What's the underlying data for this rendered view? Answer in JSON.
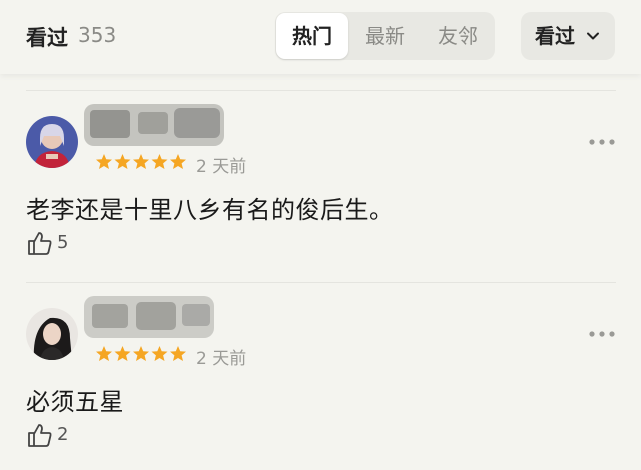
{
  "header": {
    "title": "看过",
    "count": "353",
    "tabs": [
      {
        "label": "热门",
        "active": true
      },
      {
        "label": "最新",
        "active": false
      },
      {
        "label": "友邻",
        "active": false
      }
    ],
    "filter_label": "看过",
    "filter_icon": "chevron-down-icon"
  },
  "reviews": [
    {
      "rating": 5,
      "date": "2 天前",
      "content": "老李还是十里八乡有名的俊后生。",
      "likes": "5"
    },
    {
      "rating": 5,
      "date": "2 天前",
      "content": "必须五星",
      "likes": "2"
    }
  ],
  "colors": {
    "background": "#f4f4ef",
    "star": "#f5a623",
    "muted": "#8a8a86",
    "active_tab_bg": "#ffffff"
  }
}
